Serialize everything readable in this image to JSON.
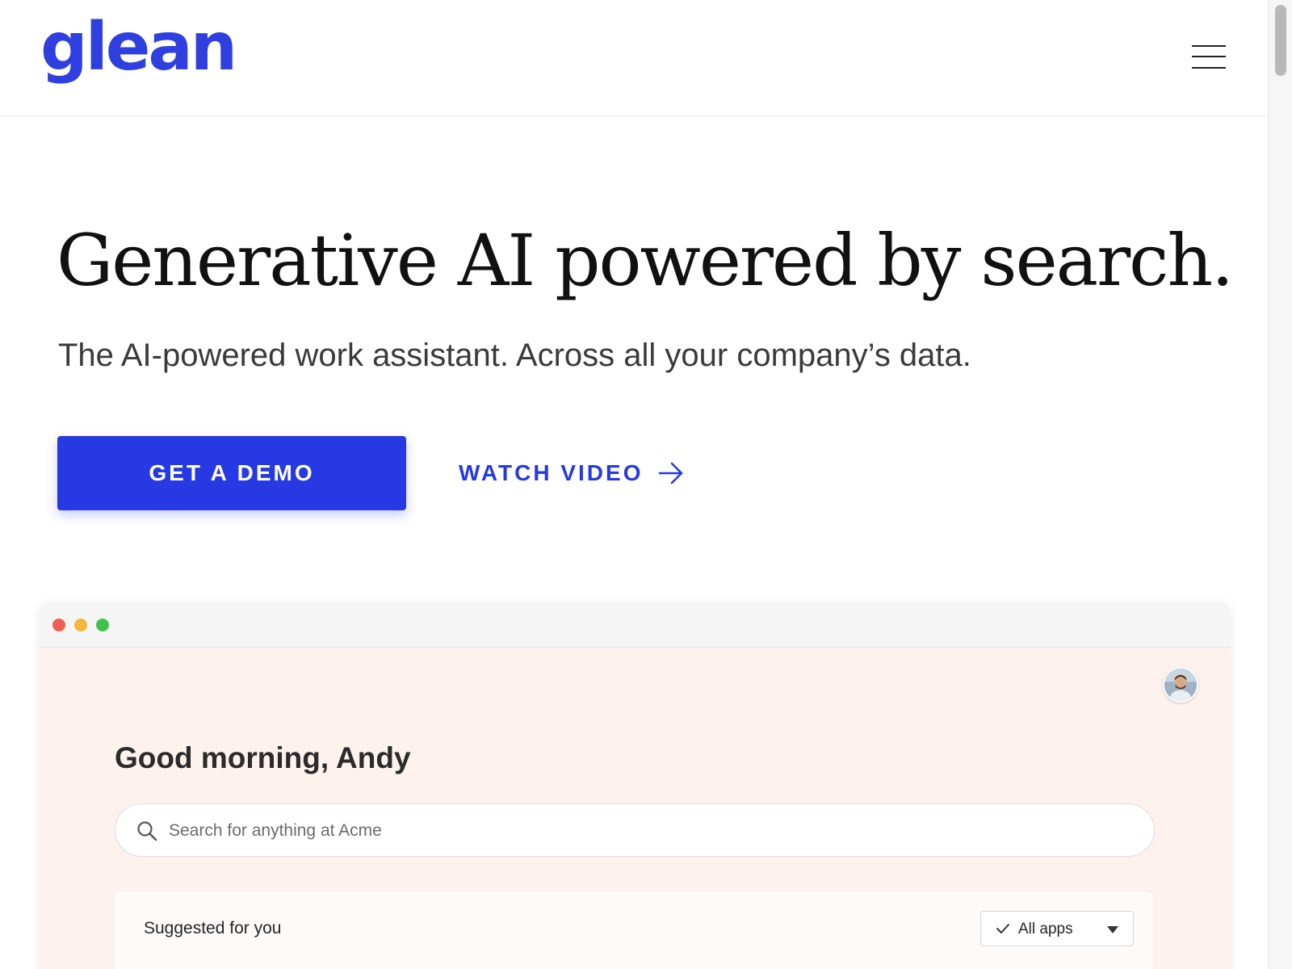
{
  "header": {
    "logo_text": "glean",
    "menu_icon": "hamburger-menu-icon"
  },
  "hero": {
    "title": "Generative AI powered by search.",
    "subtitle": "The AI-powered work assistant. Across all your company’s data.",
    "primary_cta": "GET A DEMO",
    "secondary_cta": "WATCH VIDEO",
    "secondary_cta_icon": "arrow-right-icon"
  },
  "app_preview": {
    "window_controls": [
      "close-dot-icon",
      "minimize-dot-icon",
      "zoom-dot-icon"
    ],
    "avatar_icon": "user-avatar",
    "greeting": "Good morning, Andy",
    "search": {
      "placeholder": "Search for anything at Acme",
      "value": "",
      "icon": "search-icon"
    },
    "suggested": {
      "title": "Suggested for you",
      "filter_label": "All apps",
      "filter_check_icon": "check-icon",
      "filter_caret_icon": "caret-down-icon"
    }
  },
  "colors": {
    "brand_blue": "#2639e3",
    "preview_background": "#fdf2ee",
    "text_dark": "#111111"
  }
}
